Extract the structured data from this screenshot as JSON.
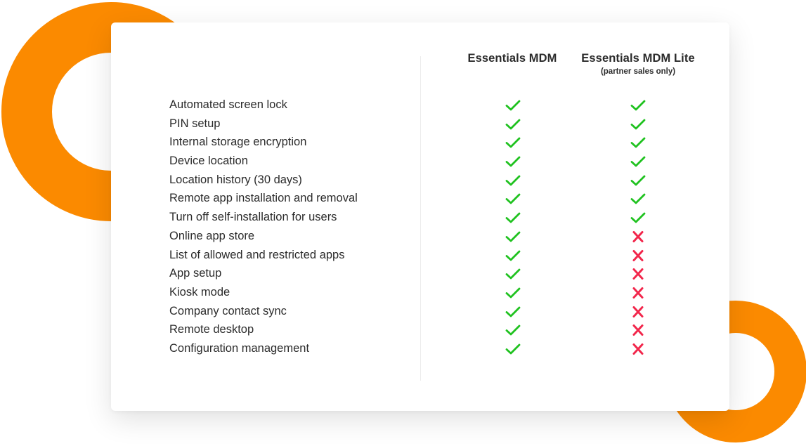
{
  "colors": {
    "accent_orange": "#fb8a00",
    "check_green": "#1fc21f",
    "cross_red": "#f2264b",
    "text": "#2b2b2b"
  },
  "columns": [
    {
      "title": "Essentials MDM",
      "subtitle": ""
    },
    {
      "title": "Essentials MDM Lite",
      "subtitle": "(partner sales only)"
    }
  ],
  "features": [
    {
      "label": "Automated screen lock",
      "mdm": "check-icon",
      "lite": "check-icon"
    },
    {
      "label": "PIN setup",
      "mdm": "check-icon",
      "lite": "check-icon"
    },
    {
      "label": "Internal storage encryption",
      "mdm": "check-icon",
      "lite": "check-icon"
    },
    {
      "label": "Device location",
      "mdm": "check-icon",
      "lite": "check-icon"
    },
    {
      "label": "Location history (30 days)",
      "mdm": "check-icon",
      "lite": "check-icon"
    },
    {
      "label": "Remote app installation and removal",
      "mdm": "check-icon",
      "lite": "check-icon"
    },
    {
      "label": "Turn off self-installation for users",
      "mdm": "check-icon",
      "lite": "check-icon"
    },
    {
      "label": "Online app store",
      "mdm": "check-icon",
      "lite": "cross-icon"
    },
    {
      "label": "List of allowed and restricted apps",
      "mdm": "check-icon",
      "lite": "cross-icon"
    },
    {
      "label": "App setup",
      "mdm": "check-icon",
      "lite": "cross-icon"
    },
    {
      "label": "Kiosk mode",
      "mdm": "check-icon",
      "lite": "cross-icon"
    },
    {
      "label": "Company contact sync",
      "mdm": "check-icon",
      "lite": "cross-icon"
    },
    {
      "label": "Remote desktop",
      "mdm": "check-icon",
      "lite": "cross-icon"
    },
    {
      "label": "Configuration management",
      "mdm": "check-icon",
      "lite": "cross-icon"
    }
  ]
}
